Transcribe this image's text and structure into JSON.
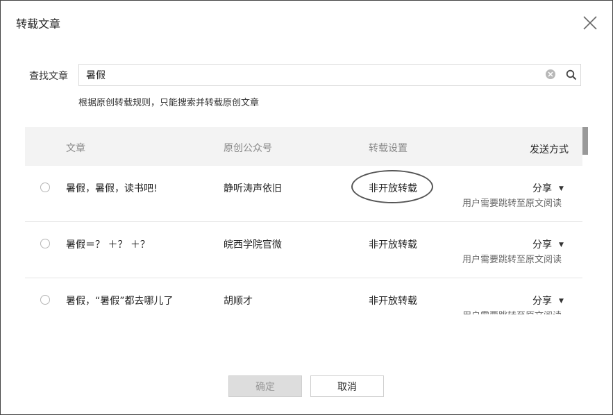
{
  "dialog": {
    "title": "转载文章"
  },
  "search": {
    "label": "查找文章",
    "value": "暑假",
    "hint": "根据原创转载规则，只能搜索并转载原创文章"
  },
  "table": {
    "headers": {
      "article": "文章",
      "account": "原创公众号",
      "setting": "转载设置",
      "send_method": "发送方式"
    },
    "rows": [
      {
        "title": "暑假，暑假，读书吧!",
        "account": "静听涛声依旧",
        "setting": "非开放转载",
        "send": "分享",
        "send_note": "用户需要跳转至原文阅读"
      },
      {
        "title": "暑假＝？ ＋？ ＋？",
        "account": "皖西学院官微",
        "setting": "非开放转载",
        "send": "分享",
        "send_note": "用户需要跳转至原文阅读"
      },
      {
        "title": "暑假，“暑假”都去哪儿了",
        "account": "胡顺才",
        "setting": "非开放转载",
        "send": "分享",
        "send_note": "用户需要跳转至原文阅读"
      }
    ]
  },
  "buttons": {
    "confirm": "确定",
    "cancel": "取消"
  },
  "icons": {
    "close": "close-icon",
    "clear": "clear-icon",
    "search": "search-icon",
    "dropdown": "chevron-down-icon"
  }
}
